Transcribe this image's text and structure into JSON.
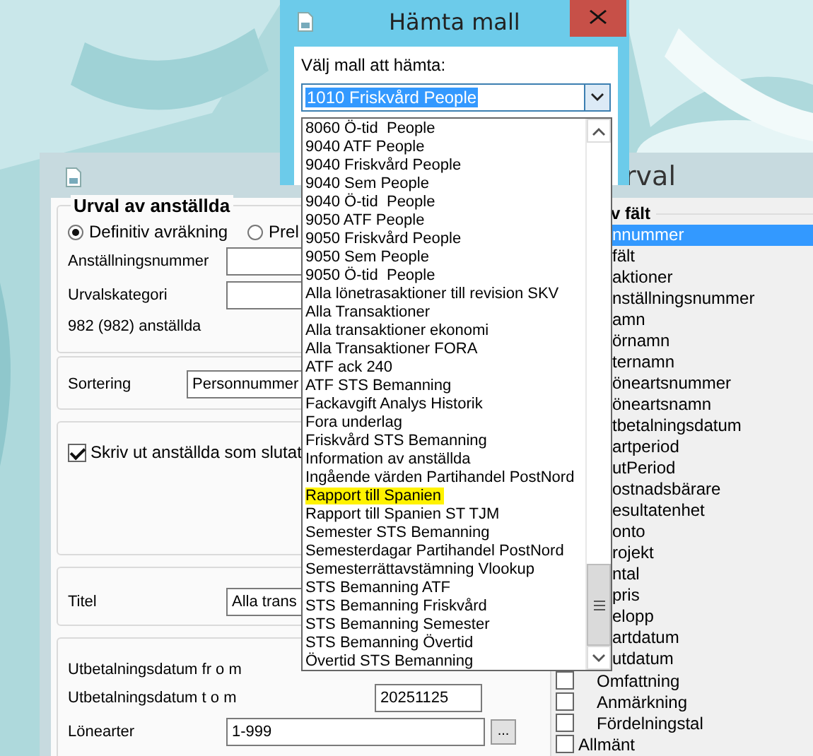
{
  "back_window": {
    "title": "rval",
    "selection_group": {
      "legend": "Urval av anställda",
      "radios": [
        {
          "label": "Definitiv avräkning",
          "selected": true
        },
        {
          "label": "Prel",
          "selected": false
        }
      ],
      "fields": [
        {
          "label": "Anställningsnummer"
        },
        {
          "label": "Urvalskategori"
        }
      ],
      "count": "982 (982) anställda"
    },
    "sorting": {
      "label": "Sortering",
      "value": "Personnummer"
    },
    "print_option": {
      "label": "Skriv ut anställda som slutat",
      "checked": true
    },
    "title_field": {
      "label": "Titel",
      "value": "Alla trans"
    },
    "dates": {
      "from_label": "Utbetalningsdatum fr o m",
      "to_label": "Utbetalningsdatum t o m",
      "to_value": "20251125"
    },
    "ranges": [
      {
        "label": "Lönearter",
        "value": "1-999",
        "button": "..."
      }
    ],
    "fields_panel": {
      "heading": "v fält",
      "items": [
        {
          "label": "nnummer",
          "selected": true
        },
        {
          "label": "fält",
          "selected": false
        },
        {
          "label": "aktioner",
          "selected": false
        },
        {
          "label": "nställningsnummer",
          "selected": false
        },
        {
          "label": "amn",
          "selected": false
        },
        {
          "label": "örnamn",
          "selected": false
        },
        {
          "label": "ternamn",
          "selected": false
        },
        {
          "label": "öneartsnummer",
          "selected": false
        },
        {
          "label": "öneartsnamn",
          "selected": false
        },
        {
          "label": "tbetalningsdatum",
          "selected": false
        },
        {
          "label": "artperiod",
          "selected": false
        },
        {
          "label": "utPeriod",
          "selected": false
        },
        {
          "label": "ostnadsbärare",
          "selected": false
        },
        {
          "label": "esultatenhet",
          "selected": false
        },
        {
          "label": "onto",
          "selected": false
        },
        {
          "label": "rojekt",
          "selected": false
        },
        {
          "label": "ntal",
          "selected": false
        },
        {
          "label": "pris",
          "selected": false
        },
        {
          "label": "elopp",
          "selected": false
        },
        {
          "label": "artdatum",
          "selected": false
        },
        {
          "label": "utdatum",
          "selected": false
        }
      ],
      "tree": [
        {
          "children": [
            {
              "label": "Omfattning",
              "checked": false
            },
            {
              "label": "Anmärkning",
              "checked": false
            },
            {
              "label": "Fördelningstal",
              "checked": false
            }
          ]
        },
        {
          "label": "Allmänt",
          "checked": false
        }
      ]
    }
  },
  "dialog": {
    "title": "Hämta mall",
    "prompt": "Välj mall att hämta:",
    "combo": {
      "value": "1010 Friskvård People"
    },
    "options": [
      {
        "label": "8060 Ö-tid  People",
        "highlighted": false
      },
      {
        "label": "9040 ATF People",
        "highlighted": false
      },
      {
        "label": "9040 Friskvård People",
        "highlighted": false
      },
      {
        "label": "9040 Sem People",
        "highlighted": false
      },
      {
        "label": "9040 Ö-tid  People",
        "highlighted": false
      },
      {
        "label": "9050 ATF People",
        "highlighted": false
      },
      {
        "label": "9050 Friskvård People",
        "highlighted": false
      },
      {
        "label": "9050 Sem People",
        "highlighted": false
      },
      {
        "label": "9050 Ö-tid  People",
        "highlighted": false
      },
      {
        "label": "Alla lönetrasaktioner till revision SKV",
        "highlighted": false
      },
      {
        "label": "Alla Transaktioner",
        "highlighted": false
      },
      {
        "label": "Alla transaktioner ekonomi",
        "highlighted": false
      },
      {
        "label": "Alla Transaktioner FORA",
        "highlighted": false
      },
      {
        "label": "ATF ack 240",
        "highlighted": false
      },
      {
        "label": "ATF STS Bemanning",
        "highlighted": false
      },
      {
        "label": "Fackavgift Analys Historik",
        "highlighted": false
      },
      {
        "label": "Fora underlag",
        "highlighted": false
      },
      {
        "label": "Friskvård STS Bemanning",
        "highlighted": false
      },
      {
        "label": "Information av anställda",
        "highlighted": false
      },
      {
        "label": "Ingående värden Partihandel PostNord",
        "highlighted": false
      },
      {
        "label": "Rapport till Spanien",
        "highlighted": true
      },
      {
        "label": "Rapport till Spanien ST TJM",
        "highlighted": false
      },
      {
        "label": "Semester STS Bemanning",
        "highlighted": false
      },
      {
        "label": "Semesterdagar Partihandel PostNord",
        "highlighted": false
      },
      {
        "label": "Semesterrättavstämning Vlookup",
        "highlighted": false
      },
      {
        "label": "STS Bemanning ATF",
        "highlighted": false
      },
      {
        "label": "STS Bemanning Friskvård",
        "highlighted": false
      },
      {
        "label": "STS Bemanning Semester",
        "highlighted": false
      },
      {
        "label": "STS Bemanning Övertid",
        "highlighted": false
      },
      {
        "label": "Övertid STS Bemanning",
        "highlighted": false
      }
    ]
  }
}
